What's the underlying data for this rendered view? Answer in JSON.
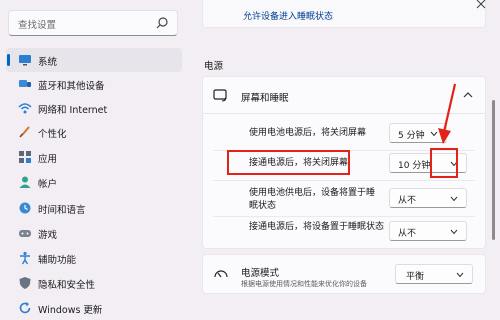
{
  "search": {
    "placeholder": "查找设置"
  },
  "sidebar": {
    "items": [
      {
        "label": "系统",
        "icon": "monitor-icon",
        "active": true
      },
      {
        "label": "蓝牙和其他设备",
        "icon": "bluetooth-icon"
      },
      {
        "label": "网络和 Internet",
        "icon": "wifi-icon"
      },
      {
        "label": "个性化",
        "icon": "brush-icon"
      },
      {
        "label": "应用",
        "icon": "apps-icon"
      },
      {
        "label": "帐户",
        "icon": "person-icon"
      },
      {
        "label": "时间和语言",
        "icon": "globe-clock-icon"
      },
      {
        "label": "游戏",
        "icon": "gamepad-icon"
      },
      {
        "label": "辅助功能",
        "icon": "accessibility-icon"
      },
      {
        "label": "隐私和安全性",
        "icon": "shield-icon"
      },
      {
        "label": "Windows 更新",
        "icon": "update-icon"
      }
    ]
  },
  "main": {
    "top_link": "允许设备进入睡眠状态",
    "section_title": "电源",
    "screen_sleep": {
      "title": "屏幕和睡眠",
      "rows": [
        {
          "label": "使用电池电源后，将关闭屏幕",
          "value": "5 分钟"
        },
        {
          "label": "接通电源后，将关闭屏幕",
          "value": "10 分钟"
        },
        {
          "label_line1": "使用电池供电后，设备将置于睡",
          "label_line2": "眠状态",
          "value": "从不"
        },
        {
          "label": "接通电源后，将设备置于睡眠状态",
          "value": "从不"
        }
      ]
    },
    "power_mode": {
      "title": "电源模式",
      "subtitle": "根据电源使用情况和性能来优化你的设备",
      "value": "平衡"
    }
  },
  "colors": {
    "accent": "#0067c0",
    "highlight": "#e2231a",
    "link": "#003e92"
  }
}
